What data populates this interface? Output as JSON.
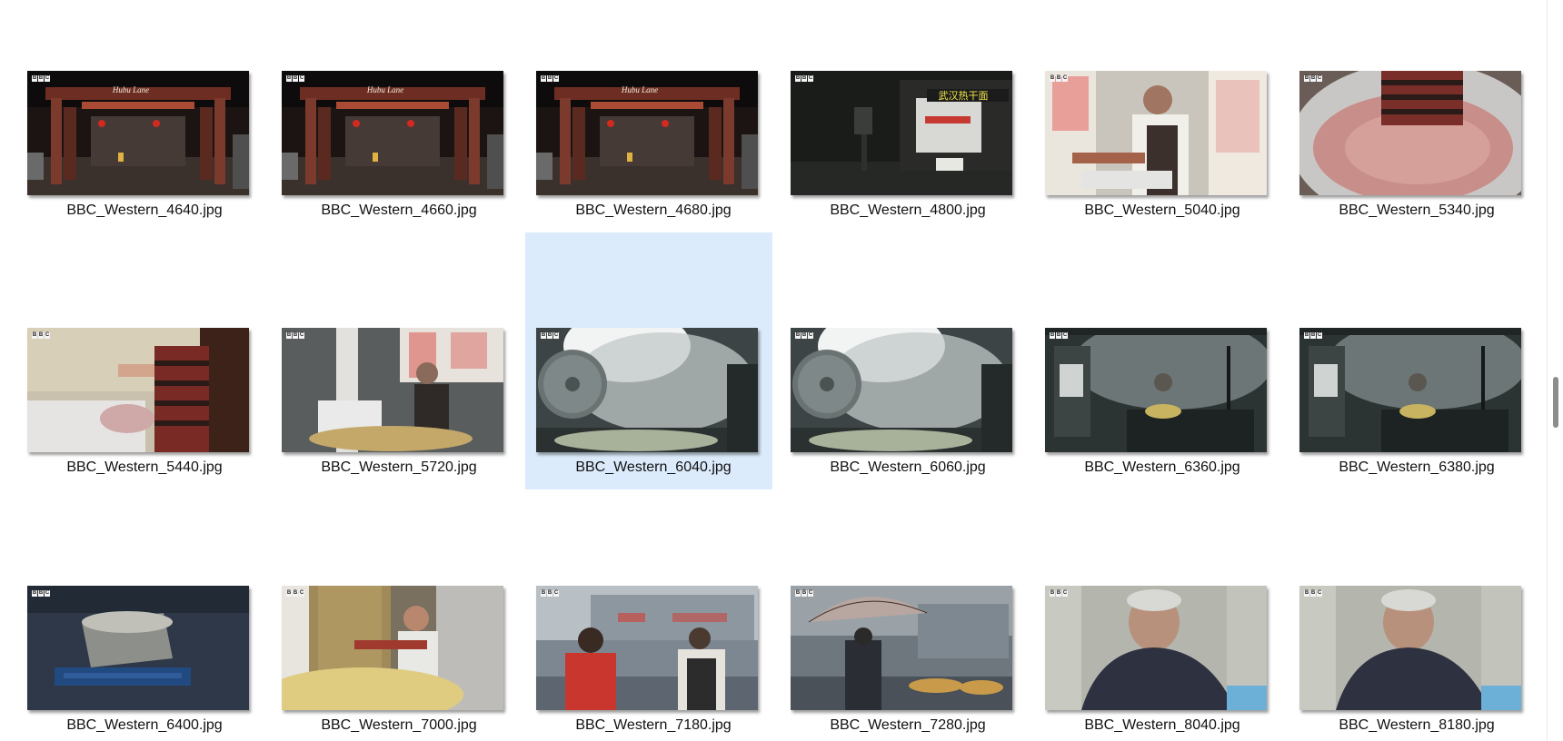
{
  "window": {
    "view": "large-icons"
  },
  "colors": {
    "selection": "#dcebfb",
    "scroll_thumb": "#8c8c8c"
  },
  "files": [
    {
      "name": "BBC_Western_4640.jpg",
      "scene": "street-gate",
      "selected": false
    },
    {
      "name": "BBC_Western_4660.jpg",
      "scene": "street-gate",
      "selected": false
    },
    {
      "name": "BBC_Western_4680.jpg",
      "scene": "street-gate",
      "selected": false
    },
    {
      "name": "BBC_Western_4800.jpg",
      "scene": "night-shop",
      "selected": false
    },
    {
      "name": "BBC_Western_5040.jpg",
      "scene": "cook-apron",
      "selected": false
    },
    {
      "name": "BBC_Western_5340.jpg",
      "scene": "meat-bowl",
      "selected": false
    },
    {
      "name": "BBC_Western_5440.jpg",
      "scene": "noodles-hand",
      "selected": false
    },
    {
      "name": "BBC_Western_5720.jpg",
      "scene": "cook-kitchen",
      "selected": false
    },
    {
      "name": "BBC_Western_6040.jpg",
      "scene": "steam-fan",
      "selected": true
    },
    {
      "name": "BBC_Western_6060.jpg",
      "scene": "steam-fan",
      "selected": false
    },
    {
      "name": "BBC_Western_6360.jpg",
      "scene": "dark-kitchen",
      "selected": false
    },
    {
      "name": "BBC_Western_6380.jpg",
      "scene": "dark-kitchen",
      "selected": false
    },
    {
      "name": "BBC_Western_6400.jpg",
      "scene": "basket-blue",
      "selected": false
    },
    {
      "name": "BBC_Western_7000.jpg",
      "scene": "woman-noodles",
      "selected": false
    },
    {
      "name": "BBC_Western_7180.jpg",
      "scene": "street-women",
      "selected": false
    },
    {
      "name": "BBC_Western_7280.jpg",
      "scene": "umbrella",
      "selected": false
    },
    {
      "name": "BBC_Western_8040.jpg",
      "scene": "man-eating",
      "selected": false
    },
    {
      "name": "BBC_Western_8180.jpg",
      "scene": "man-eating",
      "selected": false
    }
  ],
  "thumb_text": {
    "gate_sign": "Hubu Lane",
    "shop_sign": "武汉热干面"
  },
  "icons": {
    "bbc_logo": "bbc-logo-icon",
    "scroll": "scrollbar-thumb"
  }
}
